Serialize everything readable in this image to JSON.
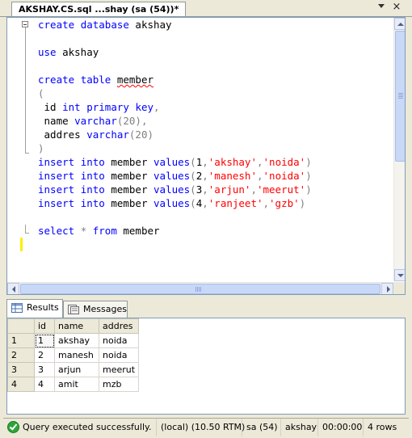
{
  "document_tab": {
    "title": "AKSHAY.CS.sql ...shay (sa (54))*",
    "close_glyph": "×"
  },
  "editor": {
    "lines": [
      [
        {
          "t": "create",
          "c": "kw"
        },
        {
          "t": " "
        },
        {
          "t": "database",
          "c": "kw"
        },
        {
          "t": " akshay"
        }
      ],
      [],
      [
        {
          "t": "use",
          "c": "kw"
        },
        {
          "t": " akshay"
        }
      ],
      [],
      [
        {
          "t": "create",
          "c": "kw"
        },
        {
          "t": " "
        },
        {
          "t": "table",
          "c": "kw"
        },
        {
          "t": " "
        },
        {
          "t": "member",
          "c": "err"
        }
      ],
      [
        {
          "t": "(",
          "c": "op"
        }
      ],
      [
        {
          "t": " id "
        },
        {
          "t": "int",
          "c": "kw"
        },
        {
          "t": " "
        },
        {
          "t": "primary",
          "c": "kw"
        },
        {
          "t": " "
        },
        {
          "t": "key",
          "c": "kw"
        },
        {
          "t": ",",
          "c": "op"
        }
      ],
      [
        {
          "t": " name "
        },
        {
          "t": "varchar",
          "c": "kw"
        },
        {
          "t": "(20)",
          "c": "op"
        },
        {
          "t": ",",
          "c": "op"
        }
      ],
      [
        {
          "t": " addres "
        },
        {
          "t": "varchar",
          "c": "kw"
        },
        {
          "t": "(20)",
          "c": "op"
        }
      ],
      [
        {
          "t": ")",
          "c": "op"
        }
      ],
      [
        {
          "t": "insert",
          "c": "kw"
        },
        {
          "t": " "
        },
        {
          "t": "into",
          "c": "kw"
        },
        {
          "t": " member "
        },
        {
          "t": "values",
          "c": "kw"
        },
        {
          "t": "(",
          "c": "op"
        },
        {
          "t": "1"
        },
        {
          "t": ",",
          "c": "op"
        },
        {
          "t": "'akshay'",
          "c": "str"
        },
        {
          "t": ",",
          "c": "op"
        },
        {
          "t": "'noida'",
          "c": "str"
        },
        {
          "t": ")",
          "c": "op"
        }
      ],
      [
        {
          "t": "insert",
          "c": "kw"
        },
        {
          "t": " "
        },
        {
          "t": "into",
          "c": "kw"
        },
        {
          "t": " member "
        },
        {
          "t": "values",
          "c": "kw"
        },
        {
          "t": "(",
          "c": "op"
        },
        {
          "t": "2"
        },
        {
          "t": ",",
          "c": "op"
        },
        {
          "t": "'manesh'",
          "c": "str"
        },
        {
          "t": ",",
          "c": "op"
        },
        {
          "t": "'noida'",
          "c": "str"
        },
        {
          "t": ")",
          "c": "op"
        }
      ],
      [
        {
          "t": "insert",
          "c": "kw"
        },
        {
          "t": " "
        },
        {
          "t": "into",
          "c": "kw"
        },
        {
          "t": " member "
        },
        {
          "t": "values",
          "c": "kw"
        },
        {
          "t": "(",
          "c": "op"
        },
        {
          "t": "3"
        },
        {
          "t": ",",
          "c": "op"
        },
        {
          "t": "'arjun'",
          "c": "str"
        },
        {
          "t": ",",
          "c": "op"
        },
        {
          "t": "'meerut'",
          "c": "str"
        },
        {
          "t": ")",
          "c": "op"
        }
      ],
      [
        {
          "t": "insert",
          "c": "kw"
        },
        {
          "t": " "
        },
        {
          "t": "into",
          "c": "kw"
        },
        {
          "t": " member "
        },
        {
          "t": "values",
          "c": "kw"
        },
        {
          "t": "(",
          "c": "op"
        },
        {
          "t": "4"
        },
        {
          "t": ",",
          "c": "op"
        },
        {
          "t": "'ranjeet'",
          "c": "str"
        },
        {
          "t": ",",
          "c": "op"
        },
        {
          "t": "'gzb'",
          "c": "str"
        },
        {
          "t": ")",
          "c": "op"
        }
      ],
      [],
      [
        {
          "t": "select",
          "c": "kw"
        },
        {
          "t": " "
        },
        {
          "t": "*",
          "c": "op"
        },
        {
          "t": " "
        },
        {
          "t": "from",
          "c": "kw"
        },
        {
          "t": " member"
        }
      ]
    ]
  },
  "results_tabs": {
    "results_label": "Results",
    "messages_label": "Messages"
  },
  "grid": {
    "columns": [
      "id",
      "name",
      "addres"
    ],
    "rows": [
      {
        "row": "1",
        "cells": [
          "1",
          "akshay",
          "noida"
        ]
      },
      {
        "row": "2",
        "cells": [
          "2",
          "manesh",
          "noida"
        ]
      },
      {
        "row": "3",
        "cells": [
          "3",
          "arjun",
          "meerut"
        ]
      },
      {
        "row": "4",
        "cells": [
          "4",
          "amit",
          "mzb"
        ]
      }
    ]
  },
  "status": {
    "message": "Query executed successfully.",
    "server": "(local) (10.50 RTM)",
    "login": "sa (54)",
    "database": "akshay",
    "elapsed": "00:00:00",
    "rows": "4 rows"
  },
  "colors": {
    "keyword": "#0000ff",
    "string": "#ff0000",
    "operator": "#808080",
    "success": "#2fa33a"
  },
  "icons": [
    "dropdown-arrow-icon",
    "close-icon",
    "collapse-icon",
    "grid-icon",
    "messages-icon",
    "success-icon"
  ]
}
